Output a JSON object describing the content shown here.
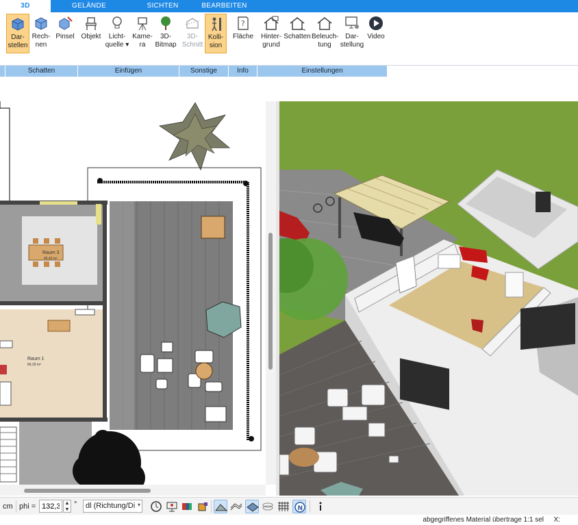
{
  "tabs": [
    "3D",
    "GELÄNDE",
    "SICHTEN",
    "BEARBEITEN"
  ],
  "ribbon": {
    "groups": [
      {
        "label": "Schatten",
        "buttons": [
          {
            "label": "Dar-\nstellen",
            "icon": "cube-render-icon",
            "selected": true
          },
          {
            "label": "Rech-\nnen",
            "icon": "cube-calc-icon"
          },
          {
            "label": "Pinsel",
            "icon": "cube-brush-icon"
          }
        ]
      },
      {
        "label": "Einfügen",
        "buttons": [
          {
            "label": "Objekt",
            "icon": "chair-icon"
          },
          {
            "label": "Licht-\nquelle ▾",
            "icon": "lightbulb-icon"
          },
          {
            "label": "Kame-\nra",
            "icon": "camera-icon"
          },
          {
            "label": "3D-\nBitmap",
            "icon": "tree-icon"
          }
        ]
      },
      {
        "label": "Sonstige",
        "buttons": [
          {
            "label": "3D-\nSchnitt",
            "icon": "section-icon",
            "disabled": true
          },
          {
            "label": "Kolli-\nsion",
            "icon": "collision-icon",
            "selected": true
          }
        ]
      },
      {
        "label": "Info",
        "buttons": [
          {
            "label": "Fläche",
            "icon": "area-info-icon"
          }
        ]
      },
      {
        "label": "Einstellungen",
        "buttons": [
          {
            "label": "Hinter-\ngrund",
            "icon": "house-background-icon"
          },
          {
            "label": "Schatten",
            "icon": "house-shadow-icon"
          },
          {
            "label": "Beleuch-\ntung",
            "icon": "house-light-icon"
          },
          {
            "label": "Dar-\nstellung",
            "icon": "display-settings-icon"
          },
          {
            "label": "Video",
            "icon": "play-icon"
          }
        ]
      }
    ]
  },
  "plan": {
    "rooms": [
      {
        "name": "Raum 3",
        "area": "45,42 m²"
      },
      {
        "name": "Raum 1",
        "area": "66,29 m²"
      }
    ]
  },
  "toolbar": {
    "unit": "cm",
    "phi_label": "phi =",
    "phi_value": "132,32",
    "degree": "°",
    "direction_value": "dl (Richtung/Di"
  },
  "status": {
    "text": "abgegriffenes Material übertrage 1:1 sel",
    "x_label": "X:"
  },
  "colors": {
    "accent": "#1e88e5",
    "group_bar": "#9bc6ee",
    "selected": "#fbd38a"
  }
}
